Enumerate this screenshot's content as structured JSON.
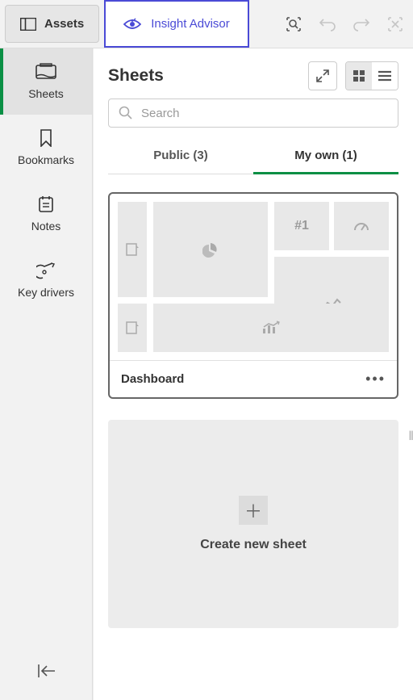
{
  "topbar": {
    "assets_label": "Assets",
    "insight_label": "Insight Advisor"
  },
  "sidebar": {
    "items": [
      {
        "label": "Sheets",
        "icon": "sheets-icon",
        "active": true
      },
      {
        "label": "Bookmarks",
        "icon": "bookmark-icon",
        "active": false
      },
      {
        "label": "Notes",
        "icon": "notes-icon",
        "active": false
      },
      {
        "label": "Key drivers",
        "icon": "keydrivers-icon",
        "active": false
      }
    ]
  },
  "header": {
    "title": "Sheets"
  },
  "search": {
    "placeholder": "Search"
  },
  "tabs": {
    "public_label": "Public (3)",
    "myown_label": "My own (1)",
    "active": "myown"
  },
  "sheets": [
    {
      "name": "Dashboard",
      "thumb_rank": "#1"
    }
  ],
  "create": {
    "label": "Create new sheet"
  }
}
